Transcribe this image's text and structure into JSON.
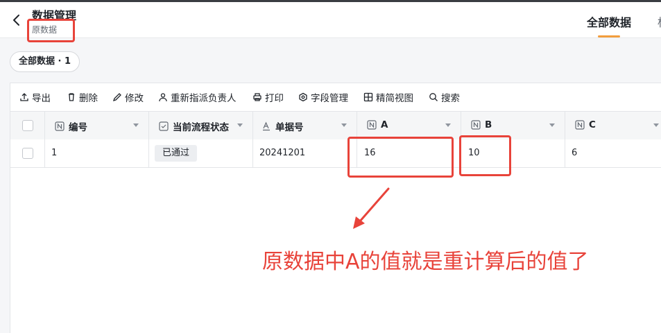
{
  "header": {
    "title": "数据管理",
    "subtitle": "原数据",
    "tabs": [
      {
        "label": "全部数据",
        "active": true
      },
      {
        "label": "标",
        "active": false
      }
    ]
  },
  "filter_chip": {
    "label": "全部数据 · 1"
  },
  "toolbar": {
    "items": [
      {
        "label": "导出",
        "icon": "export-icon"
      },
      {
        "label": "删除",
        "icon": "trash-icon"
      },
      {
        "label": "修改",
        "icon": "pencil-icon"
      },
      {
        "label": "重新指派负责人",
        "icon": "user-icon"
      },
      {
        "label": "打印",
        "icon": "printer-icon"
      },
      {
        "label": "字段管理",
        "icon": "gear-icon"
      },
      {
        "label": "精简视图",
        "icon": "grid-icon"
      },
      {
        "label": "搜索",
        "icon": "search-icon"
      }
    ]
  },
  "table": {
    "columns": [
      {
        "label": "编号",
        "icon": "number-field-icon"
      },
      {
        "label": "当前流程状态",
        "icon": "checkbox-field-icon"
      },
      {
        "label": "单据号",
        "icon": "text-field-icon"
      },
      {
        "label": "A",
        "icon": "number-field-icon"
      },
      {
        "label": "B",
        "icon": "number-field-icon"
      },
      {
        "label": "C",
        "icon": "number-field-icon"
      }
    ],
    "rows": [
      {
        "id": "1",
        "status": "已通过",
        "doc_no": "20241201",
        "a": "16",
        "b": "10",
        "c": "6"
      }
    ]
  },
  "annotation": {
    "text": "原数据中A的值就是重计算后的值了",
    "color": "#e8433a"
  },
  "colors": {
    "accent": "#f29d3d",
    "annotation": "#e8433a"
  }
}
